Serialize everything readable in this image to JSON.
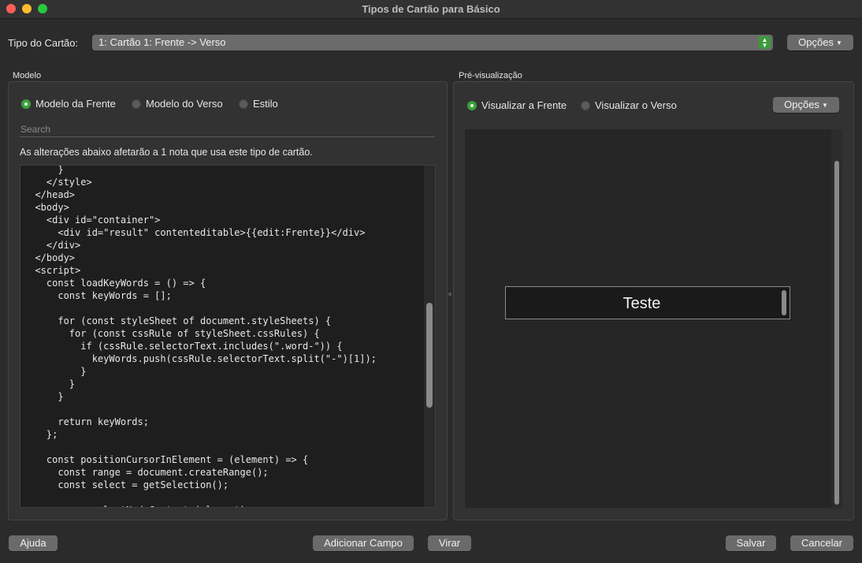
{
  "window": {
    "title": "Tipos de Cartão para Básico"
  },
  "header": {
    "card_type_label": "Tipo do Cartão:",
    "card_type_value": "1: Cartão 1: Frente -> Verso",
    "options_button": "Opções"
  },
  "template": {
    "section_label": "Modelo",
    "radios": [
      {
        "label": "Modelo da Frente",
        "selected": true
      },
      {
        "label": "Modelo do Verso",
        "selected": false
      },
      {
        "label": "Estilo",
        "selected": false
      }
    ],
    "search_placeholder": "Search",
    "info_text": "As alterações abaixo afetarão a 1 nota que usa este tipo de cartão.",
    "code_lines": [
      "      }",
      "    </style>",
      "  </head>",
      "  <body>",
      "    <div id=\"container\">",
      "      <div id=\"result\" contenteditable>{{edit:Frente}}</div>",
      "    </div>",
      "  </body>",
      "  <script>",
      "    const loadKeyWords = () => {",
      "      const keyWords = [];",
      "",
      "      for (const styleSheet of document.styleSheets) {",
      "        for (const cssRule of styleSheet.cssRules) {",
      "          if (cssRule.selectorText.includes(\".word-\")) {",
      "            keyWords.push(cssRule.selectorText.split(\"-\")[1]);",
      "          }",
      "        }",
      "      }",
      "",
      "      return keyWords;",
      "    };",
      "",
      "    const positionCursorInElement = (element) => {",
      "      const range = document.createRange();",
      "      const select = getSelection();",
      "",
      "      range.selectNodeContents(element);"
    ]
  },
  "preview": {
    "section_label": "Pré-visualização",
    "radios": [
      {
        "label": "Visualizar a Frente",
        "selected": true
      },
      {
        "label": "Visualizar o Verso",
        "selected": false
      }
    ],
    "options_button": "Opções",
    "card_text": "Teste"
  },
  "footer": {
    "help": "Ajuda",
    "add_field": "Adicionar Campo",
    "flip": "Virar",
    "save": "Salvar",
    "cancel": "Cancelar"
  }
}
